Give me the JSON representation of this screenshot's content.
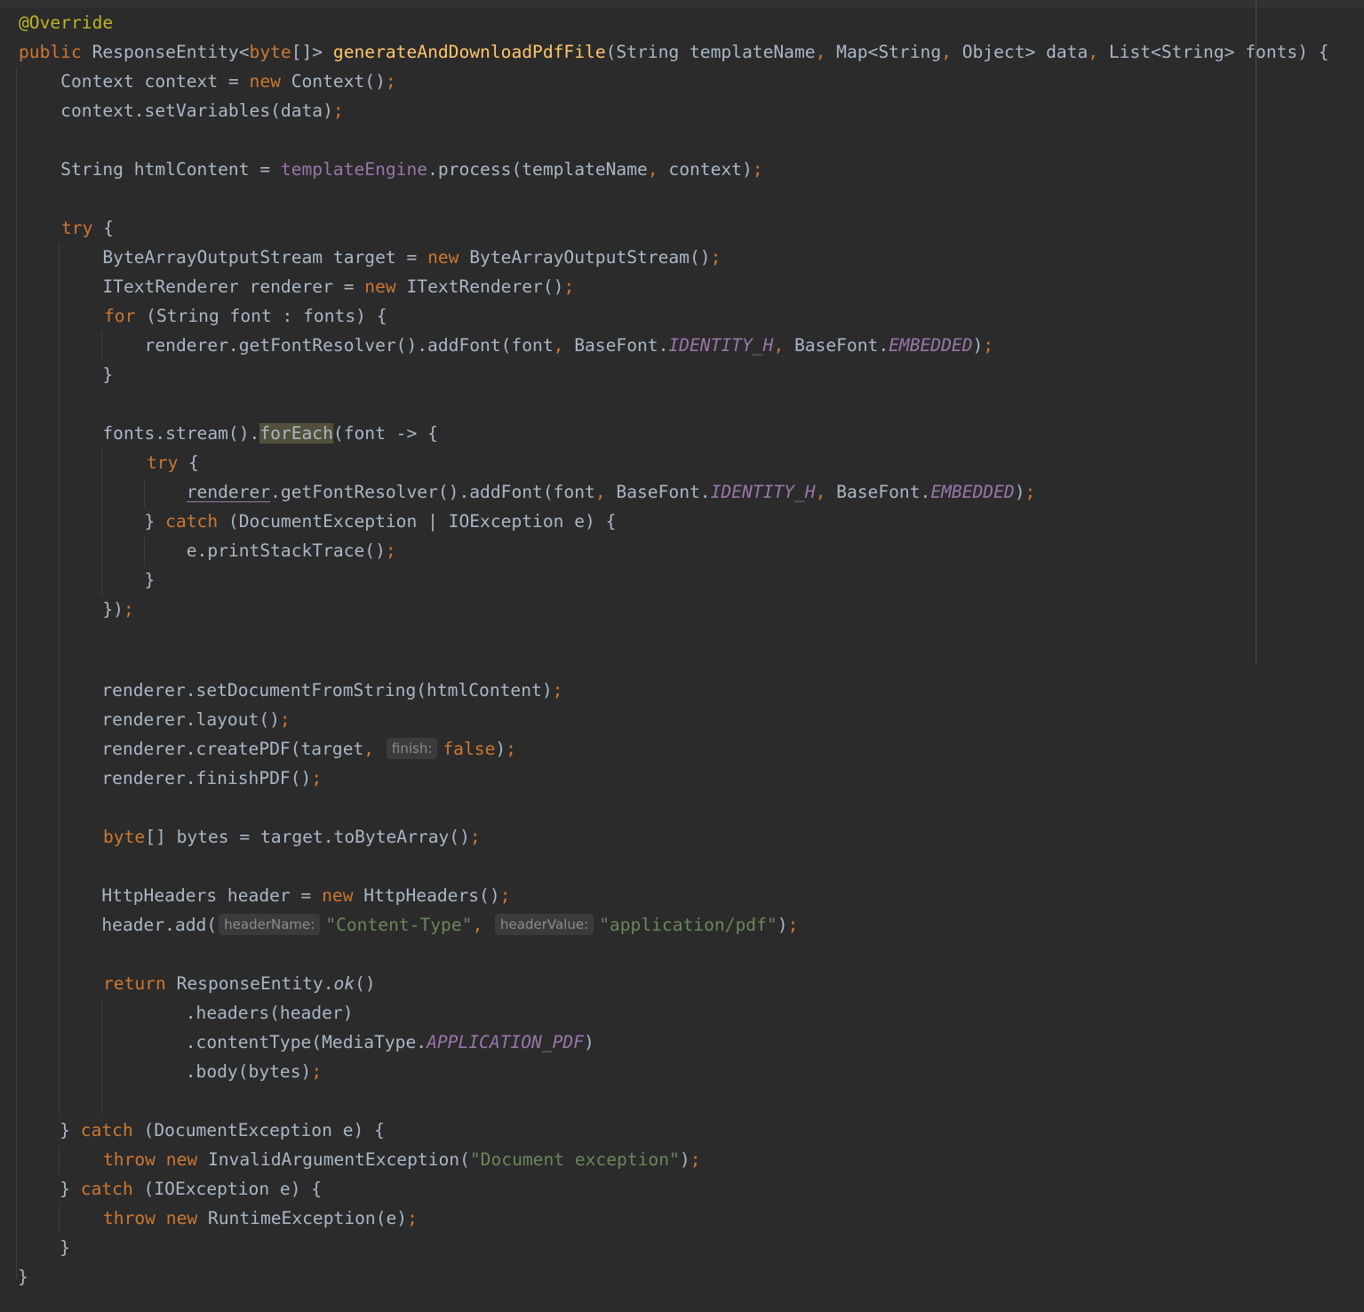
{
  "editor": {
    "language": "Java",
    "theme": "IntelliJ Darcula",
    "colors": {
      "background": "#2b2b2b",
      "text": "#a9b7c6",
      "keyword": "#cc7832",
      "annotation": "#bbb529",
      "method_declaration": "#ffc66d",
      "field": "#9876aa",
      "string": "#6a8759",
      "inlay_hint": "#8c8c8c"
    }
  },
  "code": {
    "annotation": "@Override",
    "sig": {
      "public": "public",
      "type1": "ResponseEntity<",
      "byte": "byte",
      "type2": "[]> ",
      "name": "generateAndDownloadPdfFile",
      "p1": "(String templateName",
      "c1": ",",
      "p2": " Map<String",
      "c2": ",",
      "p3": " Object> data",
      "c3": ",",
      "p4": " List<String> fonts) {"
    },
    "l3": {
      "a": "    Context context = ",
      "new": "new",
      "b": " Context()",
      "semi": ";"
    },
    "l4": {
      "a": "    context.setVariables(data)",
      "semi": ";"
    },
    "l6": {
      "a": "    String htmlContent = ",
      "field": "templateEngine",
      "b": ".process(templateName",
      "c": ",",
      "d": " context)",
      "semi": ";"
    },
    "l8": {
      "try": "try",
      "b": " {"
    },
    "l9": {
      "a": "        ByteArrayOutputStream target = ",
      "new": "new",
      "b": " ByteArrayOutputStream()",
      "semi": ";"
    },
    "l10": {
      "a": "        ITextRenderer renderer = ",
      "new": "new",
      "b": " ITextRenderer()",
      "semi": ";"
    },
    "l11": {
      "for": "for",
      "b": " (String font : fonts) {"
    },
    "l12": {
      "a": "            renderer.getFontResolver().addFont(font",
      "c1": ",",
      "b": " BaseFont.",
      "f1": "IDENTITY_H",
      "c2": ",",
      "d": " BaseFont.",
      "f2": "EMBEDDED",
      "e": ")",
      "semi": ";"
    },
    "l13": {
      "a": "        }"
    },
    "l15": {
      "a": "        fonts.stream().",
      "foreach": "forEach",
      "b": "(font -> {"
    },
    "l16": {
      "try": "try",
      "b": " {"
    },
    "l17": {
      "a": "                ",
      "var": "renderer",
      "b": ".getFontResolver().addFont(font",
      "c1": ",",
      "c": " BaseFont.",
      "f1": "IDENTITY_H",
      "c2": ",",
      "d": " BaseFont.",
      "f2": "EMBEDDED",
      "e": ")",
      "semi": ";"
    },
    "l18": {
      "a": "            } ",
      "catch": "catch",
      "b": " (DocumentException | IOException e) {"
    },
    "l19": {
      "a": "                e.printStackTrace()",
      "semi": ";"
    },
    "l20": {
      "a": "            }"
    },
    "l21": {
      "a": "        })",
      "semi": ";"
    },
    "l24": {
      "a": "        renderer.setDocumentFromString(htmlContent)",
      "semi": ";"
    },
    "l25": {
      "a": "        renderer.layout()",
      "semi": ";"
    },
    "l26": {
      "a": "        renderer.createPDF(target",
      "c": ",",
      "hint": "finish:",
      "false": "false",
      "b": ")",
      "semi": ";"
    },
    "l27": {
      "a": "        renderer.finishPDF()",
      "semi": ";"
    },
    "l29": {
      "byte": "byte",
      "b": "[] bytes = target.toByteArray()",
      "semi": ";"
    },
    "l31": {
      "a": "        HttpHeaders header = ",
      "new": "new",
      "b": " HttpHeaders()",
      "semi": ";"
    },
    "l32": {
      "a": "        header.add(",
      "hint1": "headerName:",
      "s1": "\"Content-Type\"",
      "c": ",",
      "hint2": "headerValue:",
      "s2": "\"application/pdf\"",
      "b": ")",
      "semi": ";"
    },
    "l34": {
      "return": "return",
      "b": " ResponseEntity.",
      "ok": "ok",
      "c": "()"
    },
    "l35": {
      "a": "                .headers(header)"
    },
    "l36": {
      "a": "                .contentType(MediaType.",
      "f": "APPLICATION_PDF",
      "b": ")"
    },
    "l37": {
      "a": "                .body(bytes)",
      "semi": ";"
    },
    "l39": {
      "a": "    } ",
      "catch": "catch",
      "b": " (DocumentException e) {"
    },
    "l40": {
      "throw": "throw",
      "new": "new",
      "b": " InvalidArgumentException(",
      "s": "\"Document exception\"",
      "c": ")",
      "semi": ";"
    },
    "l41": {
      "a": "    } ",
      "catch": "catch",
      "b": " (IOException e) {"
    },
    "l42": {
      "throw": "throw",
      "new": "new",
      "b": " RuntimeException(e)",
      "semi": ";"
    },
    "l43": {
      "a": "    }"
    },
    "l44": {
      "a": "}"
    }
  }
}
